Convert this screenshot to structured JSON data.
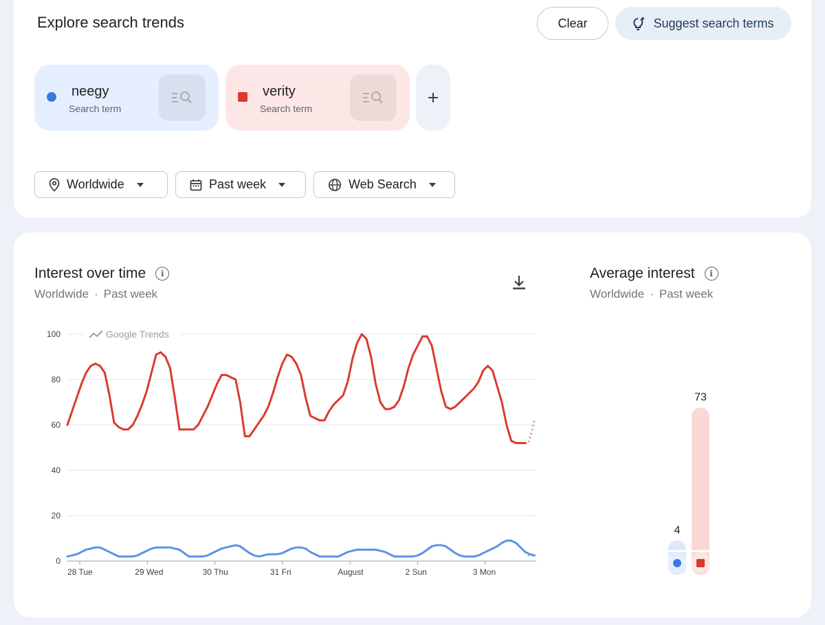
{
  "header": {
    "title": "Explore search trends",
    "clear_label": "Clear",
    "suggest_label": "Suggest search terms"
  },
  "terms": [
    {
      "name": "neegy",
      "type": "Search term",
      "color": "#3c78e0"
    },
    {
      "name": "verity",
      "type": "Search term",
      "color": "#d93a30"
    }
  ],
  "filters": {
    "location": "Worldwide",
    "time": "Past week",
    "source": "Web Search"
  },
  "interest_over_time": {
    "title": "Interest over time",
    "location": "Worldwide",
    "separator": "·",
    "period": "Past week",
    "watermark": "Google Trends"
  },
  "average_interest": {
    "title": "Average interest",
    "location": "Worldwide",
    "separator": "·",
    "period": "Past week"
  },
  "icons": {
    "suggest": "lightbulb-sparkle-icon",
    "term_action": "search-list-icon",
    "add": "plus-icon",
    "location": "location-pin-icon",
    "time": "calendar-icon",
    "source": "globe-icon",
    "info": "info-icon",
    "download": "download-icon"
  },
  "chart_data": [
    {
      "type": "line",
      "ylim": [
        0,
        100
      ],
      "y_ticks": [
        "0",
        "20",
        "40",
        "60",
        "80",
        "100"
      ],
      "x_tick_labels": [
        "28 Tue",
        "29 Wed",
        "30 Thu",
        "31 Fri",
        "August",
        "2 Sun",
        "3 Mon"
      ],
      "x": [
        0,
        1,
        2,
        3,
        4,
        5,
        6,
        7,
        8,
        9,
        10,
        11,
        12,
        13,
        14,
        15,
        16,
        17,
        18,
        19,
        20,
        21,
        22,
        23,
        24,
        25,
        26,
        27,
        28,
        29,
        30,
        31,
        32,
        33,
        34,
        35,
        36,
        37,
        38,
        39,
        40,
        41,
        42,
        43,
        44,
        45,
        46,
        47,
        48,
        49,
        50,
        51,
        52,
        53,
        54,
        55,
        56,
        57,
        58,
        59,
        60,
        61,
        62,
        63,
        64,
        65,
        66,
        67,
        68,
        69,
        70,
        71,
        72,
        73,
        74,
        75,
        76,
        77,
        78,
        79,
        80,
        81,
        82,
        83,
        84,
        85,
        86,
        87,
        88,
        89,
        90,
        91,
        92,
        93,
        94,
        95,
        96,
        97,
        98,
        99,
        100,
        101,
        102,
        103,
        104,
        105,
        106,
        107,
        108,
        109,
        110,
        111,
        112,
        113,
        114,
        115,
        116,
        117,
        118,
        119,
        120,
        121,
        122,
        123,
        124,
        125,
        126,
        127,
        128,
        129,
        130,
        131,
        132,
        133,
        134,
        135,
        136,
        137,
        138,
        139,
        140,
        141,
        142,
        143,
        144,
        145,
        146,
        147,
        148,
        149,
        150,
        151,
        152,
        153,
        154,
        155,
        156,
        157,
        158,
        159,
        160,
        161,
        162,
        163,
        164,
        165,
        166,
        167
      ],
      "series": [
        {
          "name": "verity",
          "color": "#d93a30",
          "values": [
            60,
            66,
            72,
            78,
            83,
            86,
            87,
            86,
            83,
            73,
            61,
            59,
            58,
            58,
            60,
            64,
            69,
            75,
            83,
            91,
            92,
            90,
            85,
            72,
            58,
            58,
            58,
            58,
            60,
            64,
            68,
            73,
            78,
            82,
            82,
            81,
            80,
            70,
            55,
            55,
            58,
            61,
            64,
            68,
            74,
            81,
            87,
            91,
            90,
            87,
            82,
            72,
            64,
            63,
            62,
            62,
            66,
            69,
            71,
            73,
            79,
            89,
            96,
            100,
            98,
            90,
            78,
            70,
            67,
            67,
            68,
            71,
            77,
            85,
            91,
            95,
            99,
            99,
            95,
            85,
            75,
            68,
            67,
            68,
            70,
            72,
            74,
            76,
            79,
            84,
            86,
            84,
            77,
            70,
            60,
            53,
            52,
            52,
            52
          ],
          "projection": [
            52,
            57,
            63
          ]
        },
        {
          "name": "neegy",
          "color": "#5b93e3",
          "values": [
            2,
            2.5,
            3,
            4,
            5,
            5.5,
            6,
            6,
            5,
            4,
            3,
            2,
            2,
            2,
            2,
            2.5,
            3.5,
            4.5,
            5.5,
            6,
            6,
            6,
            6,
            5.5,
            5,
            3.5,
            2,
            2,
            2,
            2,
            2.5,
            3.5,
            4.5,
            5.5,
            6,
            6.5,
            7,
            6.5,
            5,
            3.5,
            2.5,
            2,
            2.5,
            3,
            3,
            3,
            3.5,
            4.5,
            5.5,
            6,
            6,
            5.5,
            4,
            3,
            2,
            2,
            2,
            2,
            2,
            3,
            4,
            4.5,
            5,
            5,
            5,
            5,
            5,
            4.5,
            4,
            3,
            2,
            2,
            2,
            2,
            2,
            2.5,
            3.5,
            5,
            6.5,
            7,
            7,
            6.5,
            5,
            3.5,
            2.5,
            2,
            2,
            2,
            2.5,
            3.5,
            4.5,
            5.5,
            6.5,
            8,
            9,
            9,
            8,
            6,
            4,
            3,
            2.5
          ],
          "projection": [
            2.5,
            2.5,
            2.5
          ]
        }
      ]
    },
    {
      "type": "bar",
      "categories": [
        "neegy",
        "verity"
      ],
      "values": [
        4,
        73
      ],
      "ylim": [
        0,
        100
      ],
      "data_labels": [
        "4",
        "73"
      ]
    }
  ]
}
